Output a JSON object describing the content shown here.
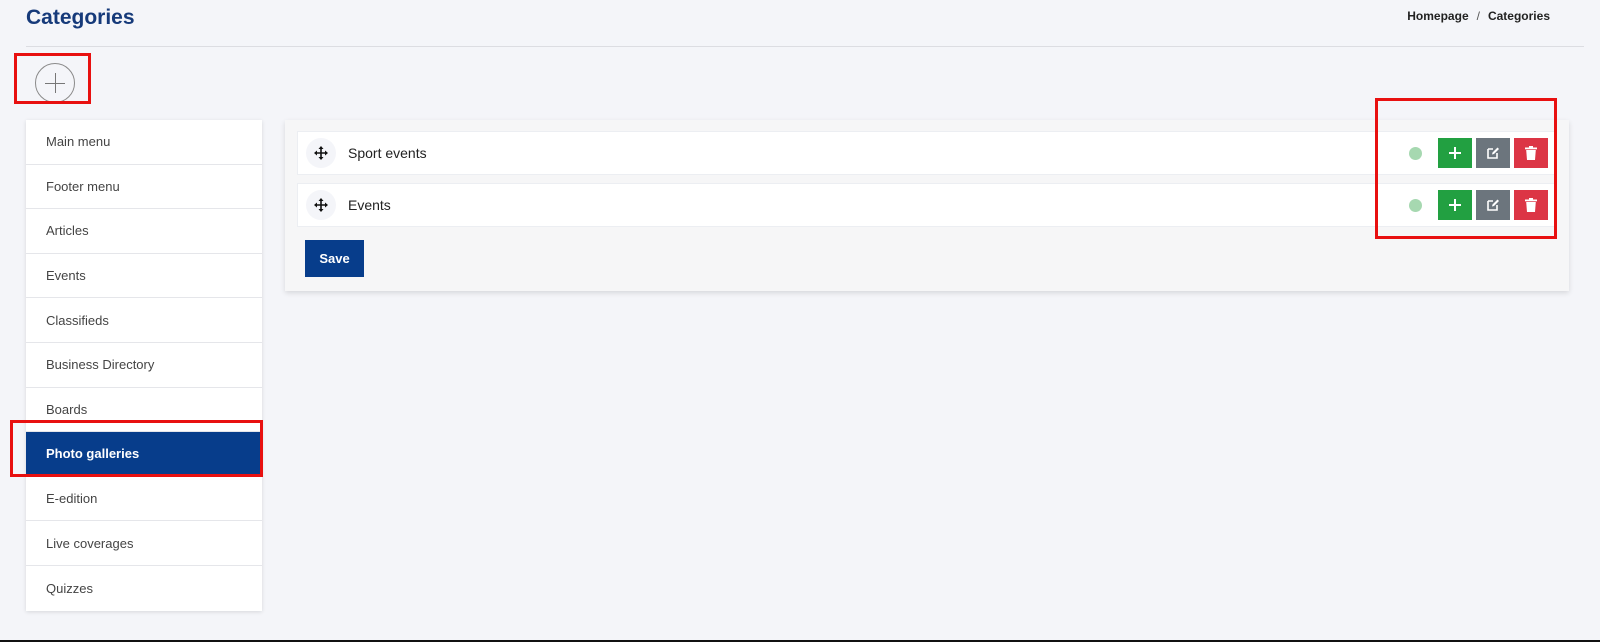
{
  "header": {
    "title": "Categories",
    "breadcrumb": [
      "Homepage",
      "Categories"
    ],
    "breadcrumb_separator": "/"
  },
  "add_button_icon": "plus-circle-icon",
  "sidebar": {
    "items": [
      {
        "label": "Main menu",
        "active": false
      },
      {
        "label": "Footer menu",
        "active": false
      },
      {
        "label": "Articles",
        "active": false
      },
      {
        "label": "Events",
        "active": false
      },
      {
        "label": "Classifieds",
        "active": false
      },
      {
        "label": "Business Directory",
        "active": false
      },
      {
        "label": "Boards",
        "active": false
      },
      {
        "label": "Photo galleries",
        "active": true
      },
      {
        "label": "E-edition",
        "active": false
      },
      {
        "label": "Live coverages",
        "active": false
      },
      {
        "label": "Quizzes",
        "active": false
      }
    ]
  },
  "categories": [
    {
      "label": "Sport events",
      "status_color": "#a6d8b0"
    },
    {
      "label": "Events",
      "status_color": "#a6d8b0"
    }
  ],
  "actions": {
    "add_icon": "plus-icon",
    "edit_icon": "edit-icon",
    "delete_icon": "trash-icon"
  },
  "save_label": "Save",
  "colors": {
    "primary": "#073d8b",
    "title": "#163a7a",
    "add": "#22a041",
    "edit": "#6c757d",
    "delete": "#dc3545",
    "highlight": "#e81010"
  }
}
